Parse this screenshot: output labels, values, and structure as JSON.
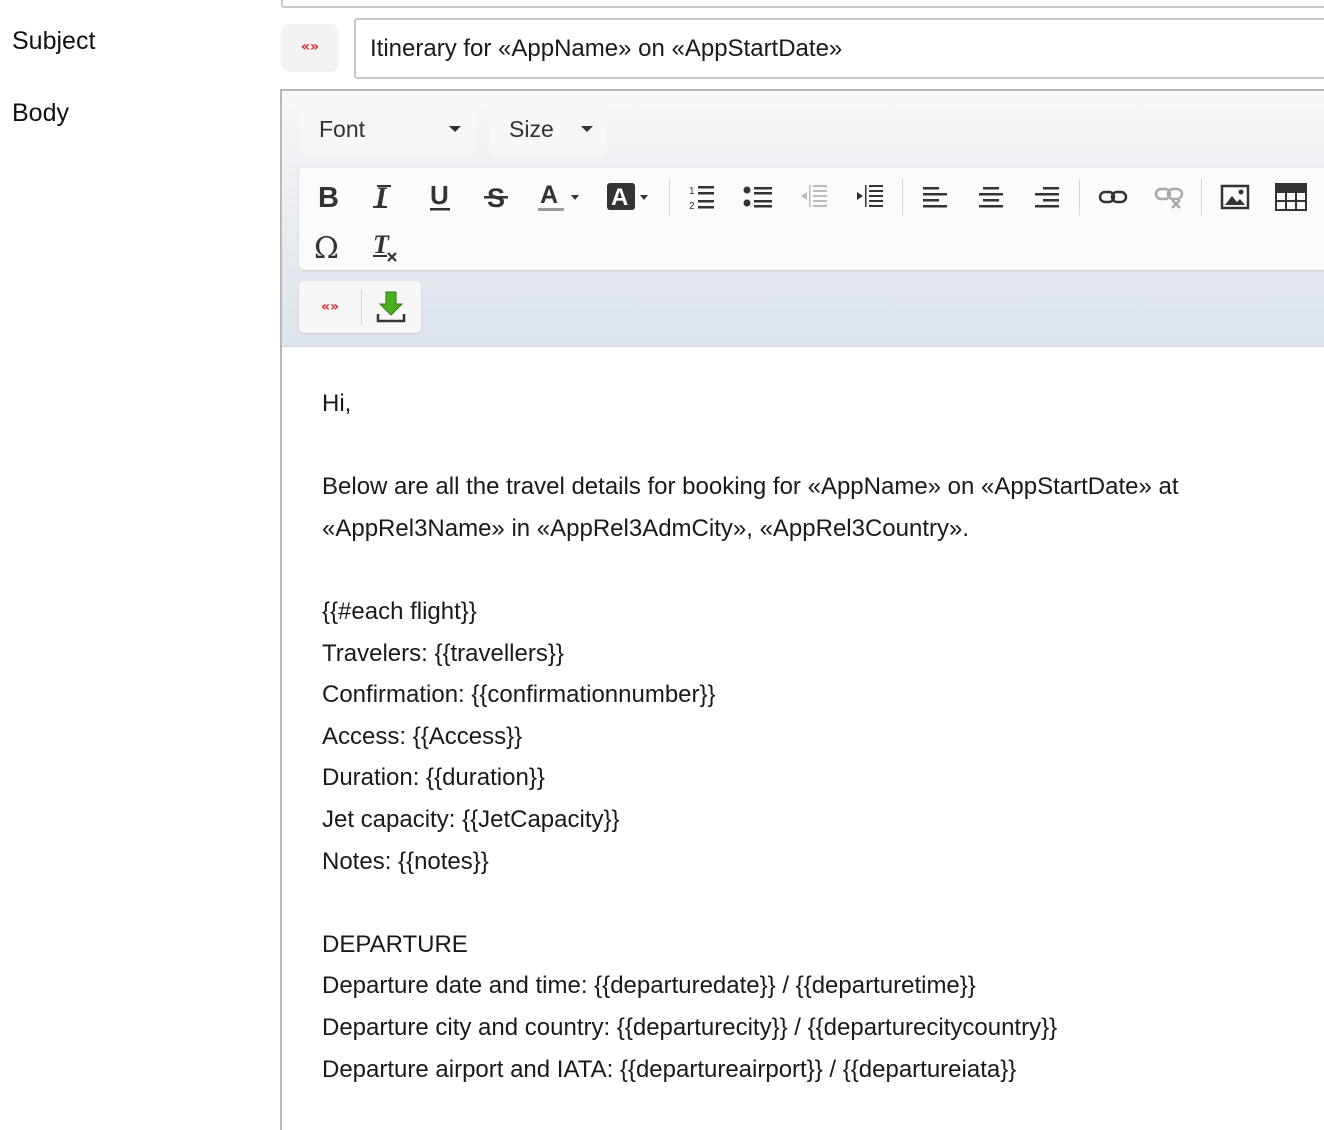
{
  "form": {
    "subject_label": "Subject",
    "body_label": "Body",
    "subject_value": "Itinerary for «AppName» on «AppStartDate»",
    "merge_field_glyph": "«»"
  },
  "toolbar": {
    "font_label": "Font",
    "size_label": "Size",
    "buttons": [
      "bold",
      "italic",
      "underline",
      "strikethrough",
      "text-color",
      "background-color",
      "numbered-list",
      "bulleted-list",
      "decrease-indent",
      "increase-indent",
      "align-left",
      "align-center",
      "align-right",
      "link",
      "unlink",
      "image",
      "table",
      "special-character",
      "remove-format"
    ],
    "merge_glyph": "«»",
    "download_icon": "download-icon",
    "colors": {
      "merge_red": "#e0242b",
      "download_green": "#4caf1f"
    }
  },
  "body": {
    "lines": [
      "Hi,",
      "",
      "Below are all the travel details for booking for «AppName» on «AppStartDate» at",
      "«AppRel3Name» in «AppRel3AdmCity», «AppRel3Country».",
      "",
      "{{#each flight}}",
      "Travelers: {{travellers}}",
      "Confirmation: {{confirmationnumber}}",
      "Access: {{Access}}",
      "Duration: {{duration}}",
      "Jet capacity: {{JetCapacity}}",
      "Notes: {{notes}}",
      "",
      "DEPARTURE",
      "Departure date and time: {{departuredate}} / {{departuretime}}",
      "Departure city and country: {{departurecity}} / {{departurecitycountry}}",
      "Departure airport and IATA: {{departureairport}} / {{departureiata}}"
    ]
  }
}
